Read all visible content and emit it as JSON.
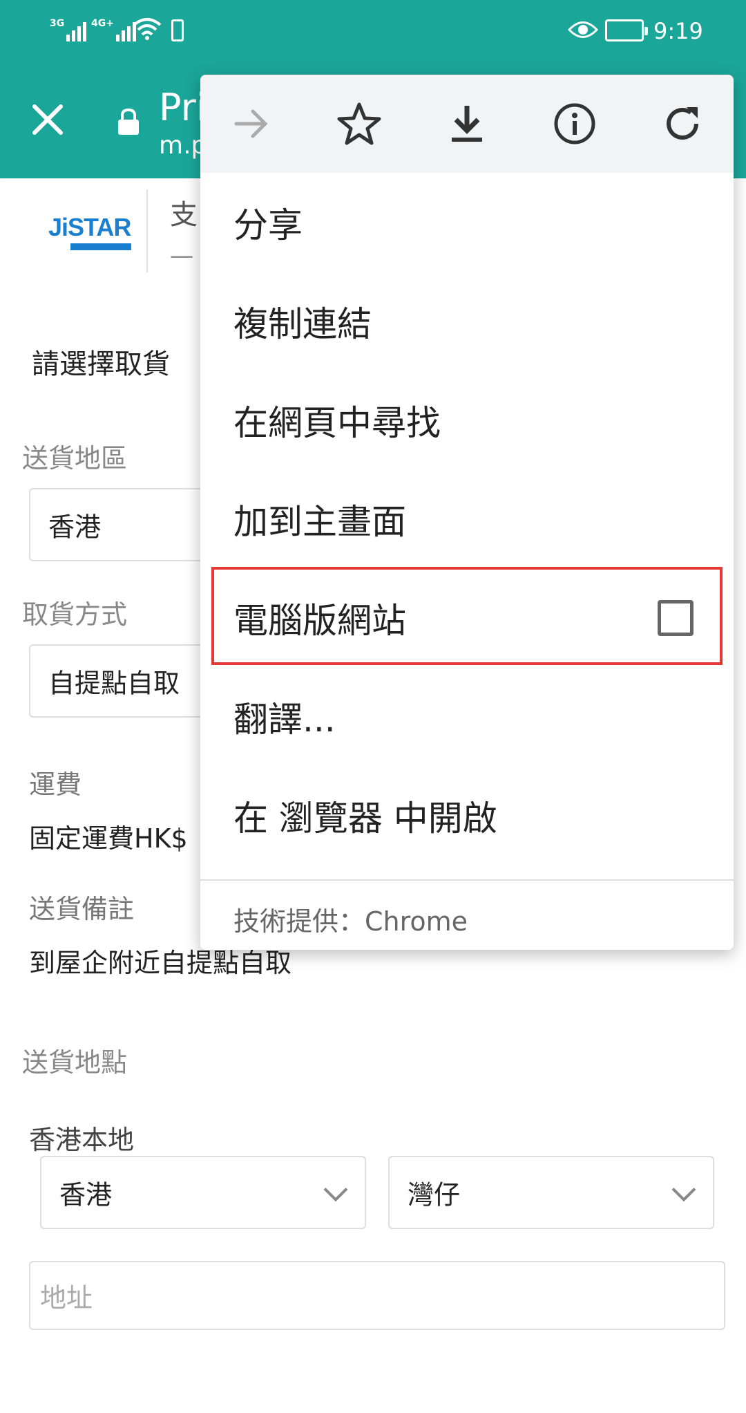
{
  "status_bar": {
    "sim1": "3G",
    "sim2": "4G+",
    "time": "9:19"
  },
  "app_bar": {
    "title": "Pri",
    "url": "m.p"
  },
  "site_header": {
    "logo_text": "JiSTAR",
    "line1": "支",
    "line2": "一"
  },
  "form": {
    "heading": "請選擇取貨",
    "region_label": "送貨地區",
    "region_value": "香港",
    "method_label": "取貨方式",
    "method_value": "自提點自取",
    "fee_label": "運費",
    "fee_value": "固定運費HK$",
    "note_label": "送貨備註",
    "note_value": "到屋企附近自提點自取",
    "location_label": "送貨地點",
    "local_label": "香港本地",
    "select_area": "香港",
    "select_district": "灣仔",
    "address_placeholder": "地址"
  },
  "menu": {
    "toolbar_icons": [
      "forward-icon",
      "bookmark-star-icon",
      "download-icon",
      "info-icon",
      "refresh-icon"
    ],
    "items": [
      {
        "label": "分享"
      },
      {
        "label": "複制連結"
      },
      {
        "label": "在網頁中尋找"
      },
      {
        "label": "加到主畫面"
      },
      {
        "label": "電腦版網站",
        "checked": false
      },
      {
        "label": "翻譯..."
      },
      {
        "label": "在 瀏覽器 中開啟"
      }
    ],
    "footer": "技術提供：Chrome"
  },
  "colors": {
    "app_bar": "#1ba69a",
    "highlight": "#e53935"
  }
}
